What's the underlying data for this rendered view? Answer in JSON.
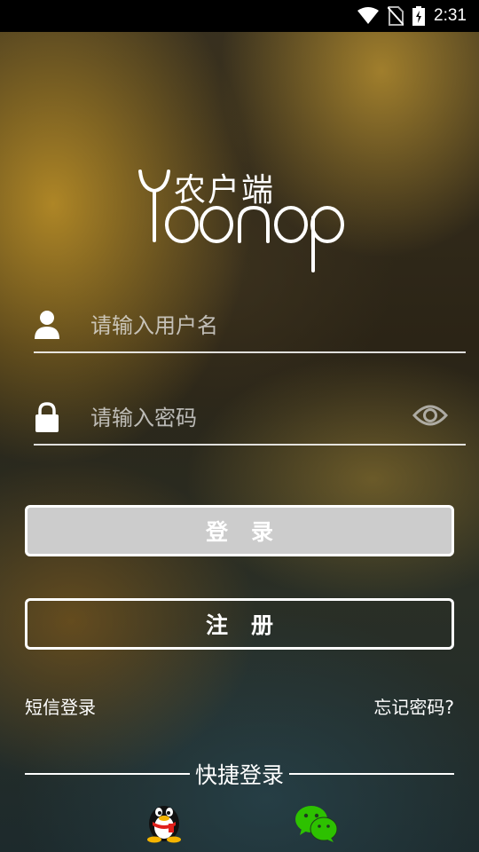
{
  "status_bar": {
    "time": "2:31"
  },
  "logo": {
    "chinese": "农户端",
    "latin": "Yoonop"
  },
  "username": {
    "placeholder": "请输入用户名",
    "value": ""
  },
  "password": {
    "placeholder": "请输入密码",
    "value": ""
  },
  "buttons": {
    "login": "登录",
    "register": "注册"
  },
  "links": {
    "sms_login": "短信登录",
    "forgot_password": "忘记密码?"
  },
  "quick_login": {
    "label": "快捷登录",
    "providers": [
      "qq-icon",
      "wechat-icon"
    ]
  },
  "colors": {
    "login_button_bg": "#cccccc",
    "wechat_green": "#2dc100"
  }
}
